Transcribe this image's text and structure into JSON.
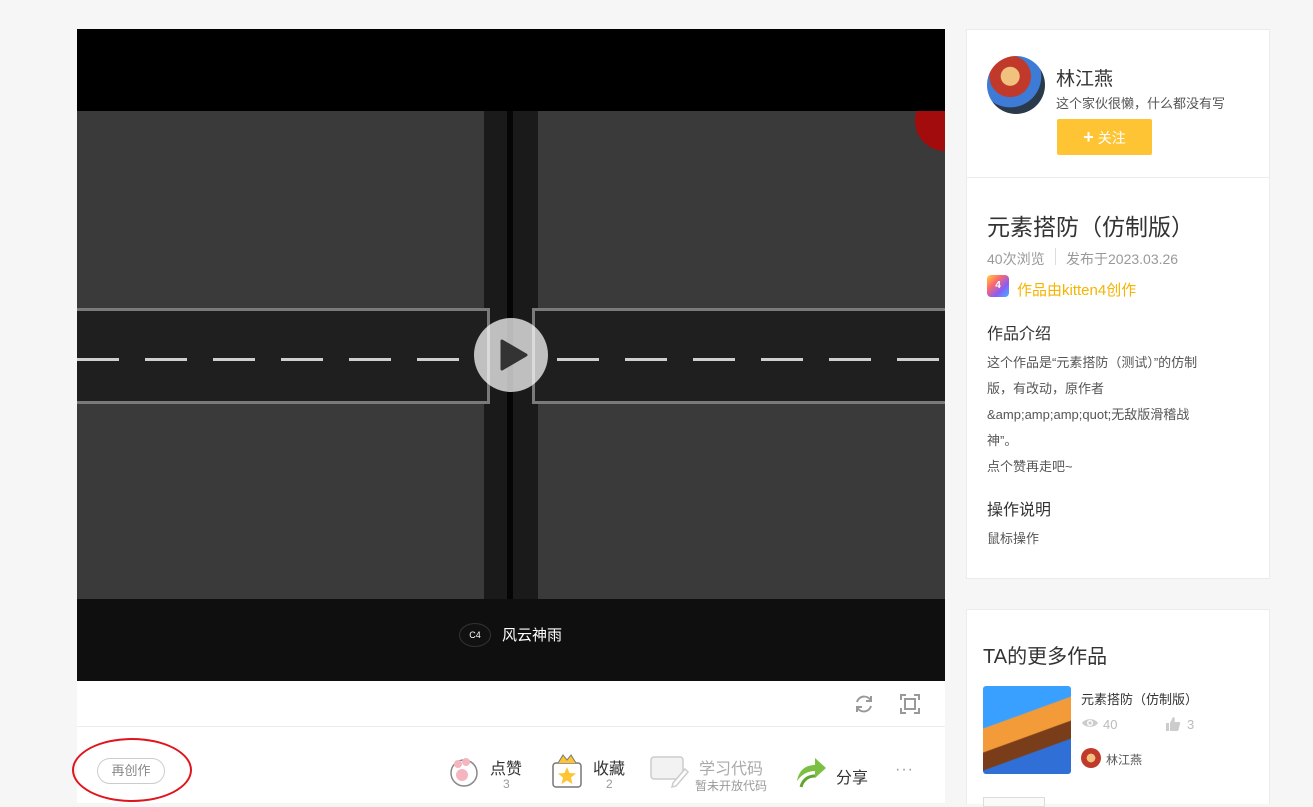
{
  "player": {
    "banner_text": "风云神雨",
    "banner_logo": "C4",
    "play_icon": "play-icon",
    "refresh_icon": "refresh-icon",
    "fullscreen_icon": "fullscreen-icon"
  },
  "actions": {
    "remix_label": "再创作",
    "like_label": "点赞",
    "like_count": "3",
    "favorite_label": "收藏",
    "favorite_count": "2",
    "learn_label": "学习代码",
    "learn_sub": "暂未开放代码",
    "share_label": "分享",
    "more_label": "···"
  },
  "author": {
    "name": "林江燕",
    "bio": "这个家伙很懒，什么都没有写",
    "follow_label": "关注"
  },
  "work": {
    "title": "元素搭防（仿制版）",
    "views": "40次浏览",
    "published": "发布于2023.03.26",
    "kitten_badge": "4",
    "made_by": "作品由kitten4创作",
    "intro_heading": "作品介绍",
    "intro_lines": [
      "这个作品是“元素搭防（测试）”的仿制",
      "版，有改动，原作者",
      "&amp;amp;amp;quot;无敌版滑稽战",
      "神”。",
      "点个赞再走吧~"
    ],
    "ops_heading": "操作说明",
    "ops_text": "鼠标操作"
  },
  "more_works": {
    "heading": "TA的更多作品",
    "items": [
      {
        "title": "元素搭防（仿制版）",
        "views": "40",
        "likes": "3",
        "author": "林江燕"
      }
    ]
  }
}
